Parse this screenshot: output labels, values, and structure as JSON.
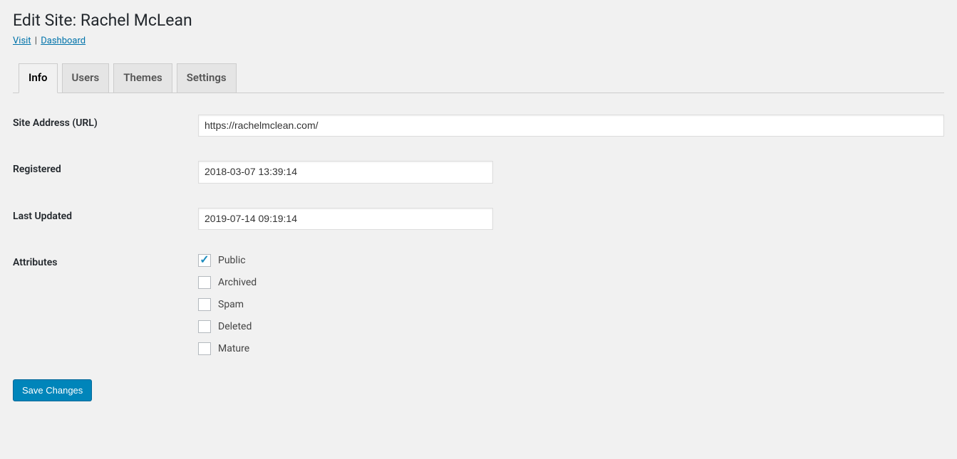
{
  "header": {
    "title": "Edit Site: Rachel McLean",
    "visit_link": "Visit",
    "dashboard_link": "Dashboard"
  },
  "tabs": {
    "info": "Info",
    "users": "Users",
    "themes": "Themes",
    "settings": "Settings"
  },
  "form": {
    "site_address_label": "Site Address (URL)",
    "site_address_value": "https://rachelmclean.com/",
    "registered_label": "Registered",
    "registered_value": "2018-03-07 13:39:14",
    "last_updated_label": "Last Updated",
    "last_updated_value": "2019-07-14 09:19:14",
    "attributes_label": "Attributes",
    "attributes": {
      "public": {
        "label": "Public",
        "checked": true
      },
      "archived": {
        "label": "Archived",
        "checked": false
      },
      "spam": {
        "label": "Spam",
        "checked": false
      },
      "deleted": {
        "label": "Deleted",
        "checked": false
      },
      "mature": {
        "label": "Mature",
        "checked": false
      }
    }
  },
  "actions": {
    "save_label": "Save Changes"
  }
}
